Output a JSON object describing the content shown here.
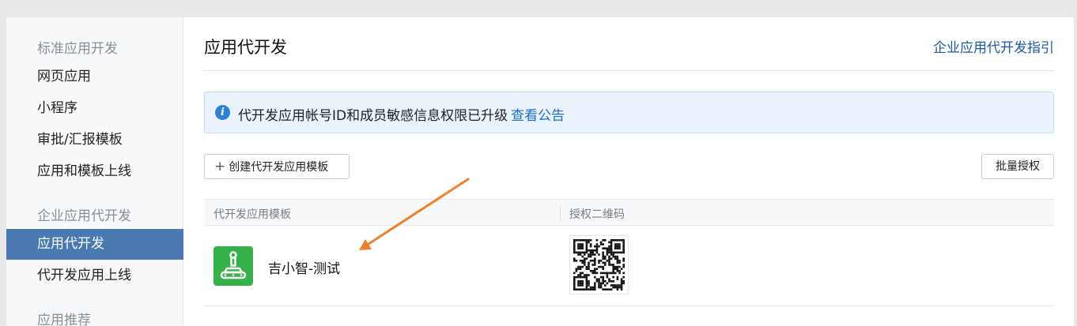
{
  "sidebar": {
    "sections": [
      {
        "title": "标准应用开发",
        "items": [
          "网页应用",
          "小程序",
          "审批/汇报模板",
          "应用和模板上线"
        ]
      },
      {
        "title": "企业应用代开发",
        "items": [
          "应用代开发",
          "代开发应用上线"
        ]
      },
      {
        "title": "应用推荐",
        "items": []
      }
    ],
    "active_item": "应用代开发"
  },
  "header": {
    "title": "应用代开发",
    "guide_link": "企业应用代开发指引"
  },
  "notice": {
    "icon": "info-icon",
    "text": "代开发应用帐号ID和成员敏感信息权限已升级",
    "link": "查看公告"
  },
  "toolbar": {
    "create_label": "创建代开发应用模板",
    "create_icon": "plus-icon",
    "batch_label": "批量授权"
  },
  "table": {
    "columns": [
      "代开发应用模板",
      "授权二维码"
    ],
    "rows": [
      {
        "name": "吉小智-测试",
        "icon": "robot-app-icon",
        "icon_color": "#36b14a",
        "qr": "qr-code-image"
      }
    ]
  },
  "colors": {
    "accent": "#4a78b0",
    "link": "#1e5aa0",
    "notice_bg": "#eaf3fc",
    "annotation_arrow": "#f07f2e"
  }
}
